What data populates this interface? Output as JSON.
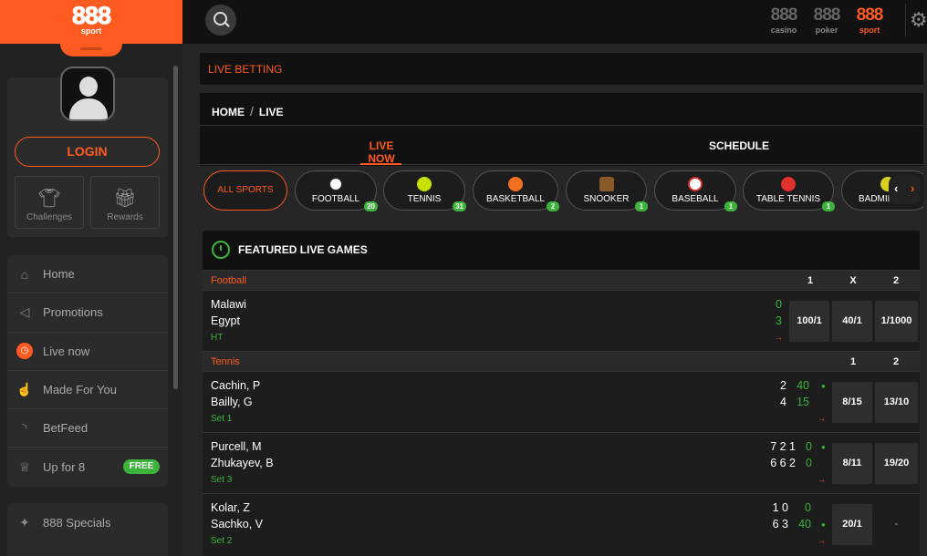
{
  "logo": {
    "mark": "888",
    "sub": "sport"
  },
  "sidebar": {
    "login_label": "LOGIN",
    "challenges_label": "Challenges",
    "rewards_label": "Rewards",
    "nav": [
      {
        "label": "Home",
        "icon": "home-icon"
      },
      {
        "label": "Promotions",
        "icon": "megaphone-icon"
      },
      {
        "label": "Live now",
        "icon": "stopwatch-icon"
      },
      {
        "label": "Made For You",
        "icon": "thumbs-up-icon"
      },
      {
        "label": "BetFeed",
        "icon": "rss-icon"
      },
      {
        "label": "Up for 8",
        "icon": "trophy-icon",
        "badge": "FREE"
      }
    ],
    "nav2": [
      {
        "label": "888 Specials",
        "icon": "star-icon"
      }
    ]
  },
  "topbar": {
    "brands": [
      {
        "mark": "888",
        "name": "casino"
      },
      {
        "mark": "888",
        "name": "poker"
      },
      {
        "mark": "888",
        "name": "sport"
      }
    ]
  },
  "header": {
    "title": "LIVE BETTING"
  },
  "breadcrumb": {
    "home": "HOME",
    "sep": "/",
    "current": "LIVE"
  },
  "tabs": {
    "live_now": "LIVE NOW",
    "schedule": "SCHEDULE"
  },
  "sports": {
    "all_label": "ALL SPORTS",
    "items": [
      {
        "label": "FOOTBALL",
        "count": "20"
      },
      {
        "label": "TENNIS",
        "count": "31"
      },
      {
        "label": "BASKETBALL",
        "count": "2"
      },
      {
        "label": "SNOOKER",
        "count": "1"
      },
      {
        "label": "BASEBALL",
        "count": "1"
      },
      {
        "label": "TABLE TENNIS",
        "count": "1"
      },
      {
        "label": "BADMINTON",
        "count": ""
      }
    ]
  },
  "featured": {
    "title": "FEATURED LIVE GAMES",
    "football": {
      "name": "Football",
      "cols": [
        "1",
        "X",
        "2"
      ],
      "match": {
        "home": "Malawi",
        "away": "Egypt",
        "home_score": "0",
        "away_score": "3",
        "status": "HT",
        "odds": [
          "100/1",
          "40/1",
          "1/1000"
        ]
      }
    },
    "tennis": {
      "name": "Tennis",
      "cols": [
        "1",
        "2"
      ],
      "matches": [
        {
          "p1": "Cachin, P",
          "p2": "Bailly, G",
          "sets1": "2",
          "sets2": "4",
          "game1": "40",
          "game2": "15",
          "status": "Set 1",
          "odds": [
            "8/15",
            "13/10"
          ]
        },
        {
          "p1": "Purcell, M",
          "p2": "Zhukayev, B",
          "sets1": "7 2 1",
          "sets2": "6 6 2",
          "game1": "0",
          "game2": "0",
          "status": "Set 3",
          "odds": [
            "8/11",
            "19/20"
          ]
        },
        {
          "p1": "Kolar, Z",
          "p2": "Sachko, V",
          "sets1": "1 0",
          "sets2": "6 3",
          "game1": "0",
          "game2": "40",
          "status": "Set 2",
          "odds": [
            "20/1",
            "-"
          ]
        }
      ]
    }
  }
}
